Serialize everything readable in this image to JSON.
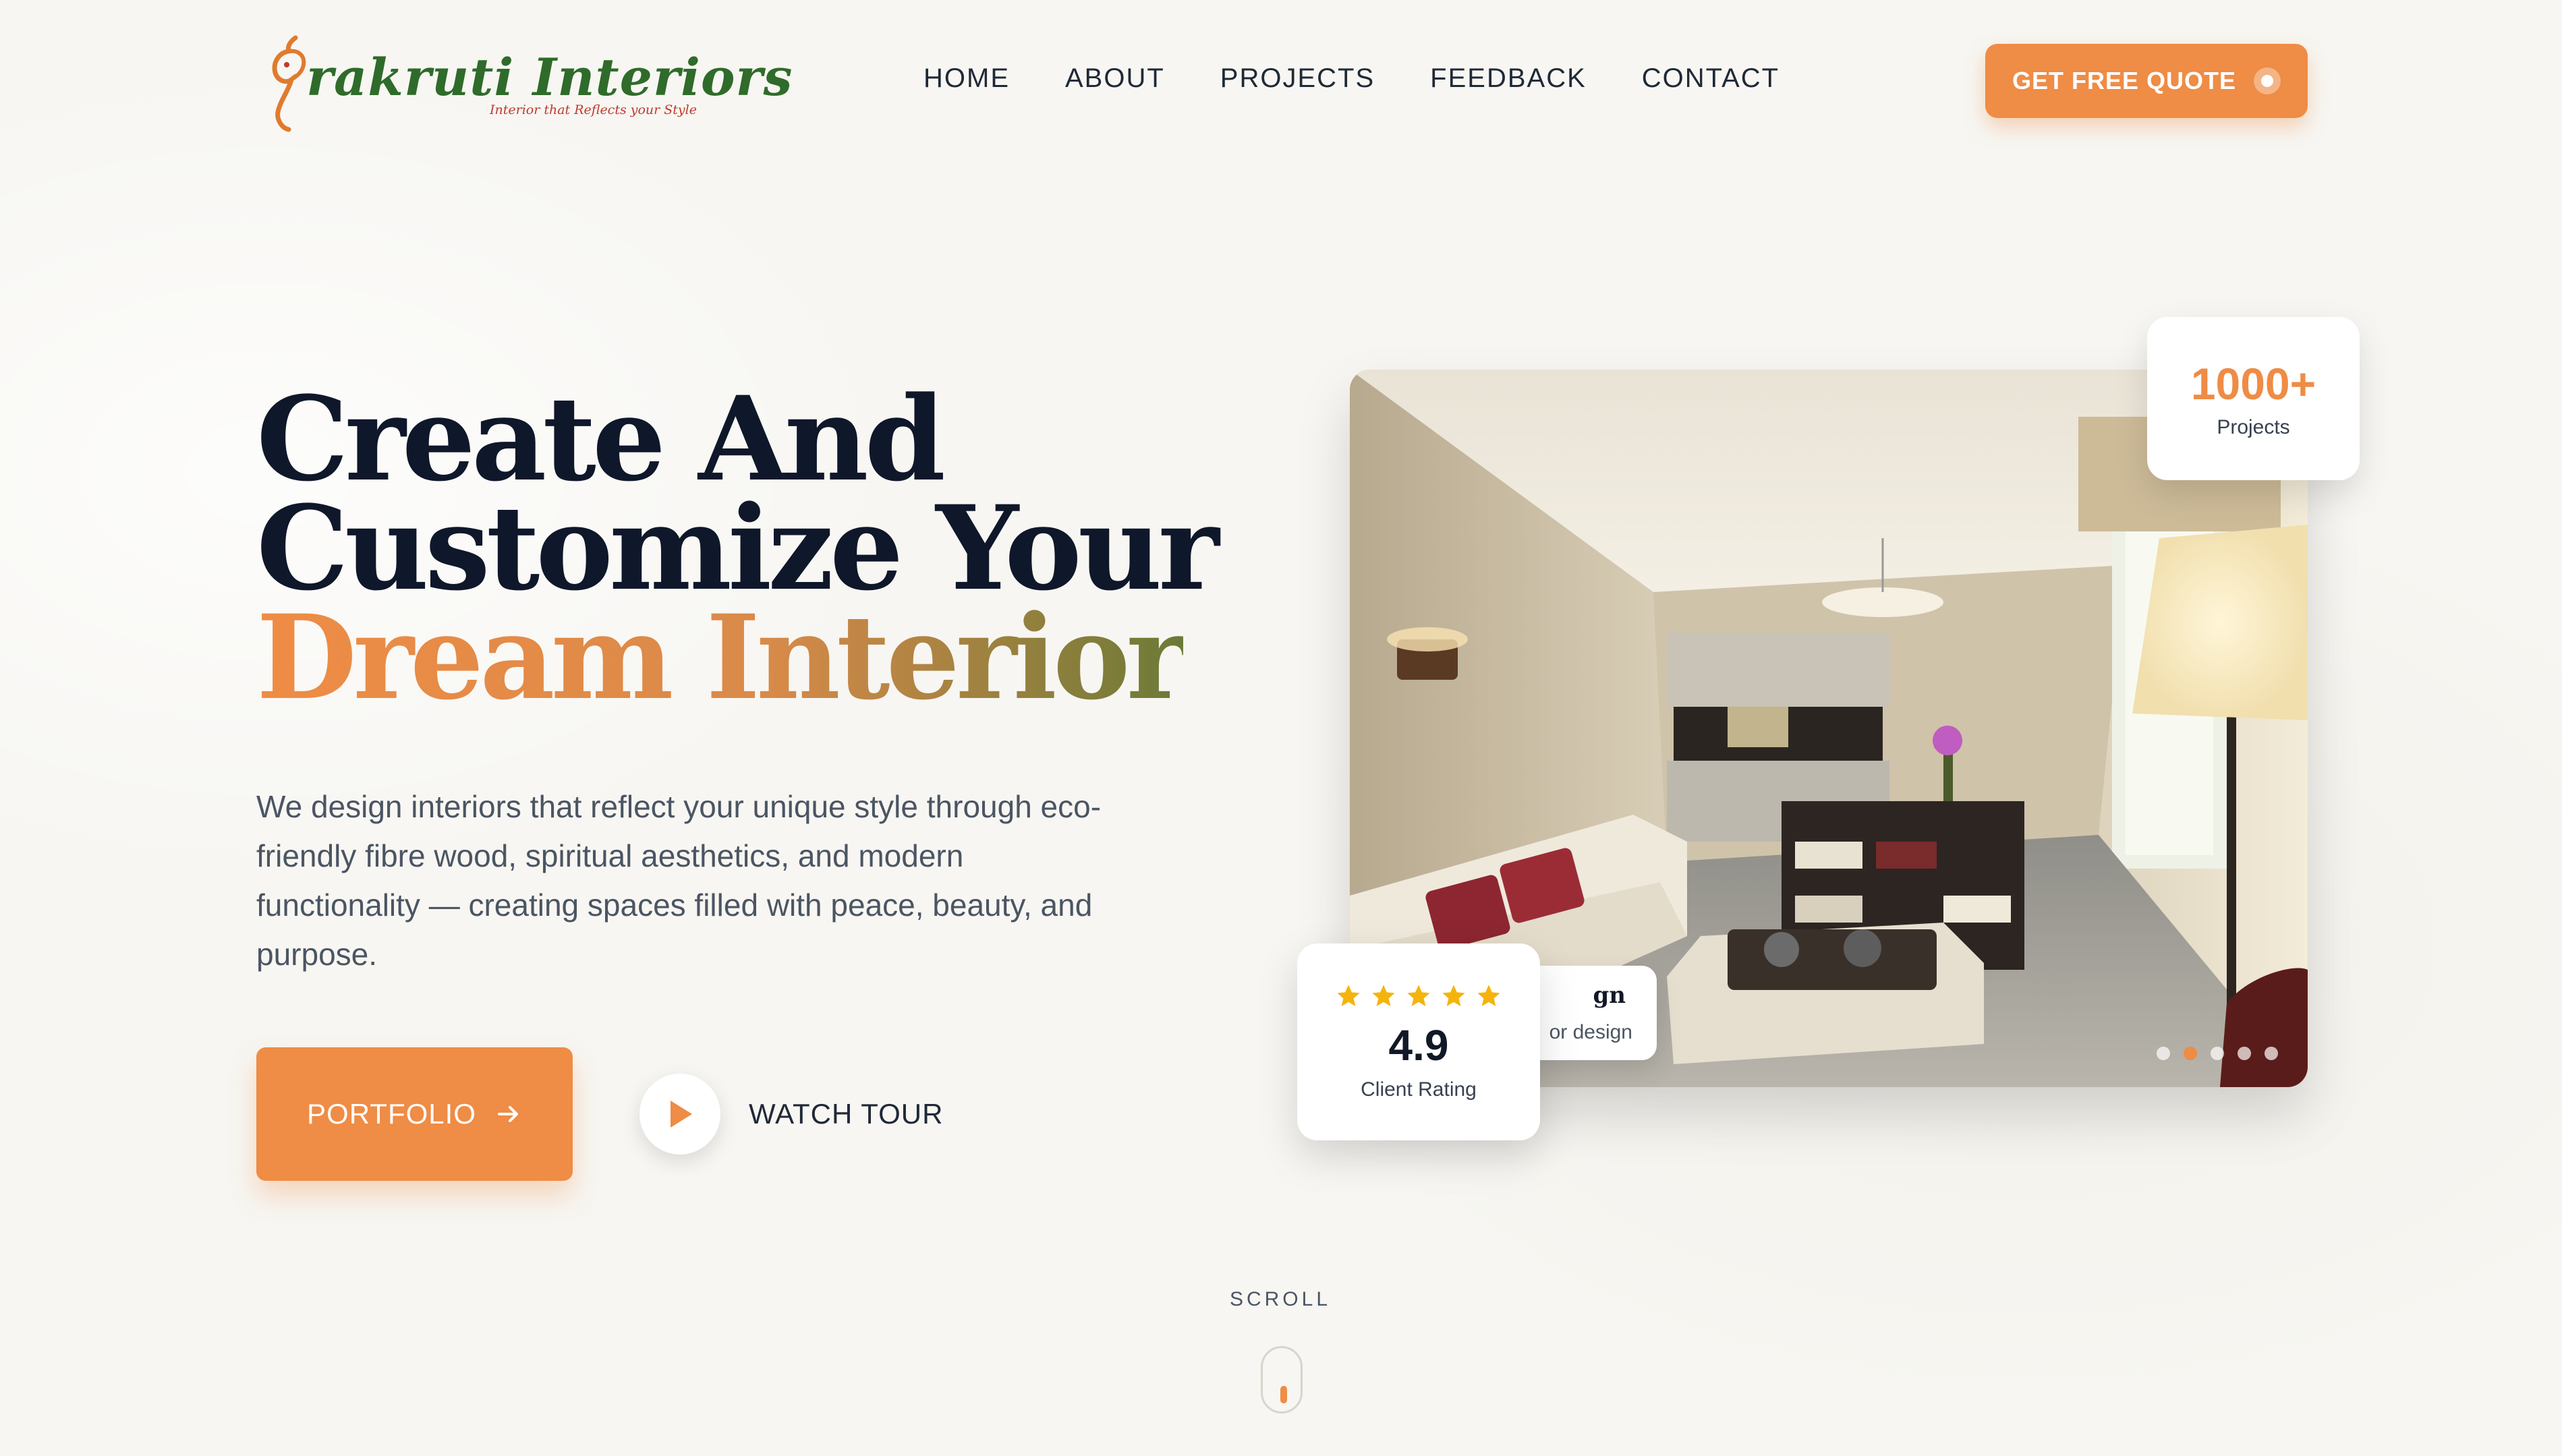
{
  "brand": {
    "name": "rakruti Interiors",
    "tagline": "Interior that Reflects your Style",
    "logo_icon": "ganesha-icon"
  },
  "nav": {
    "items": [
      "HOME",
      "ABOUT",
      "PROJECTS",
      "FEEDBACK",
      "CONTACT"
    ]
  },
  "cta": {
    "quote_label": "GET FREE QUOTE"
  },
  "hero": {
    "headline_line1": "Create And",
    "headline_line2": "Customize Your",
    "headline_accent": "Dream Interior",
    "description": "We design interiors that reflect your unique style through eco-friendly fibre wood, spiritual aesthetics, and modern functionality — creating spaces filled with peace, beauty, and purpose.",
    "portfolio_label": "PORTFOLIO",
    "watch_tour_label": "WATCH TOUR"
  },
  "stats": {
    "projects_value": "1000+",
    "projects_label": "Projects",
    "design_title": "gn",
    "design_sub": "or design",
    "rating_value": "4.9",
    "rating_label": "Client Rating",
    "rating_stars": 5
  },
  "carousel": {
    "slide_count": 5,
    "active_index": 1
  },
  "scroll": {
    "label": "SCROLL"
  },
  "colors": {
    "accent": "#ef8c45",
    "brand_green": "#2f6b2a",
    "heading": "#0f172a",
    "star": "#f5b40b"
  }
}
